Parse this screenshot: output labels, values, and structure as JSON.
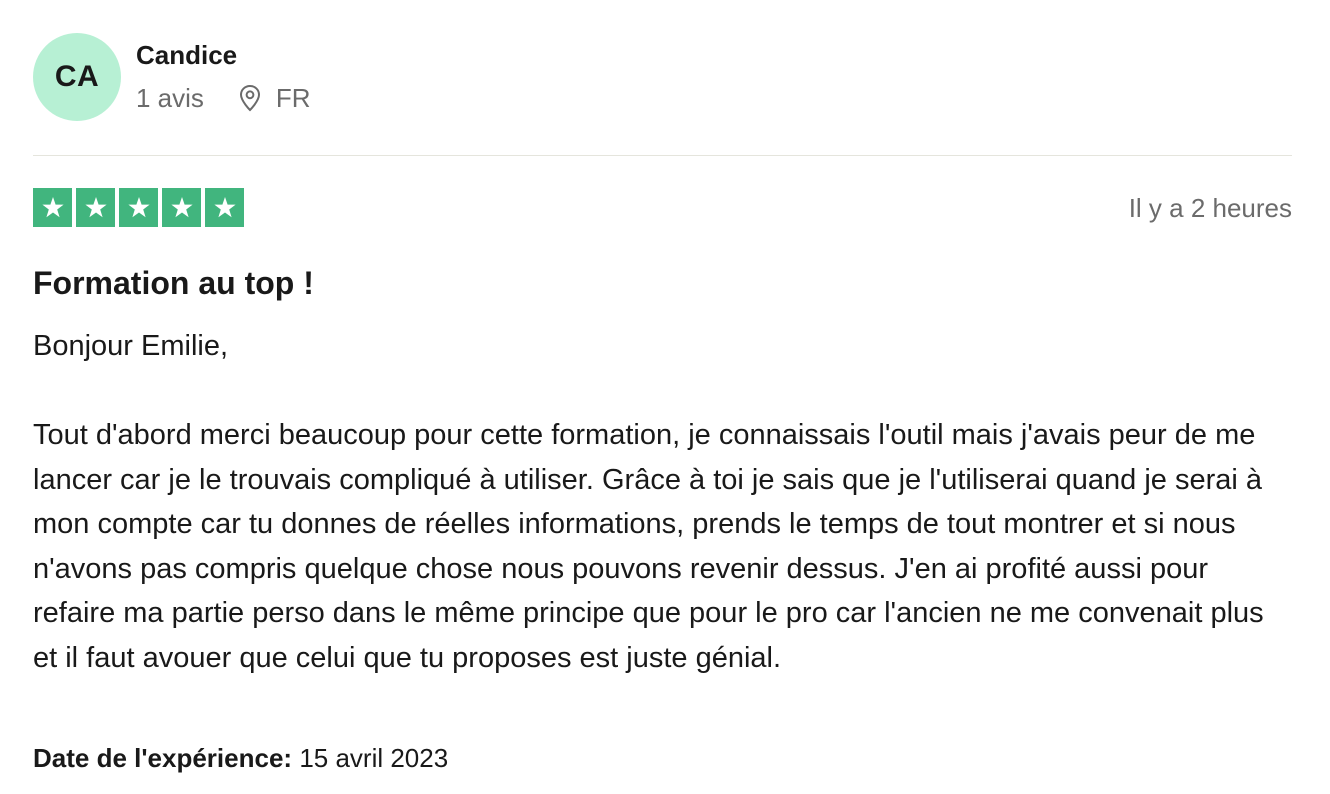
{
  "consumer": {
    "initials": "CA",
    "name": "Candice",
    "review_count": "1 avis",
    "location_icon": "map-pin-icon",
    "country": "FR"
  },
  "review": {
    "rating": 5,
    "rating_max": 5,
    "star_icon": "star-icon",
    "time_ago": "Il y a 2 heures",
    "title": "Formation au top !",
    "greeting": "Bonjour Emilie,",
    "text": "Tout d'abord merci beaucoup pour cette formation, je connaissais l'outil mais j'avais peur de me lancer car je le trouvais compliqué à utiliser. Grâce à toi je sais que je l'utiliserai quand je serai à mon compte car tu donnes de réelles informations, prends le temps de tout montrer et si nous n'avons pas compris quelque chose nous pouvons revenir dessus. J'en ai profité aussi pour refaire ma partie perso dans le même principe que pour le pro car l'ancien ne me convenait plus et il faut avouer que celui que tu proposes est juste génial.",
    "experience_label": "Date de l'expérience:",
    "experience_date": "15 avril 2023"
  },
  "colors": {
    "avatar_bg": "#b7f0d4",
    "star_green": "#41b57e",
    "muted_text": "#6b6b6b",
    "divider": "#e5e5dd"
  }
}
